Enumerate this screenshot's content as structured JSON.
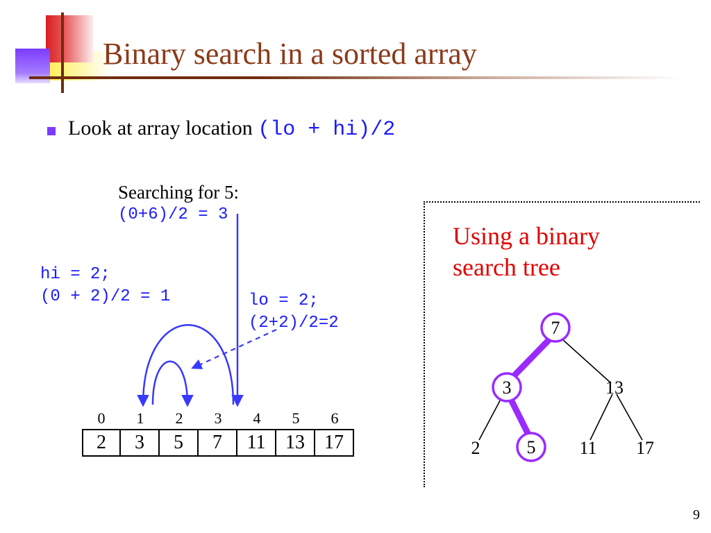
{
  "title": "Binary search in a sorted array",
  "bullet": {
    "text": "Look at array location ",
    "code": "(lo + hi)/2"
  },
  "search": {
    "heading": "Searching for 5:",
    "maincalc": "(0+6)/2 = 3",
    "hi_line1": "hi = 2;",
    "hi_line2": "(0 + 2)/2 = 1",
    "lo_line1": "lo = 2;",
    "lo_line2": "(2+2)/2=2"
  },
  "array": {
    "indices": [
      "0",
      "1",
      "2",
      "3",
      "4",
      "5",
      "6"
    ],
    "values": [
      "2",
      "3",
      "5",
      "7",
      "11",
      "13",
      "17"
    ]
  },
  "tree": {
    "title1": "Using a binary",
    "title2": "search tree",
    "nodes": {
      "root": "7",
      "l": "3",
      "r": "13",
      "ll": "2",
      "lr": "5",
      "rl": "11",
      "rr": "17"
    },
    "path": [
      "root",
      "l",
      "lr"
    ]
  },
  "slide_number": "9"
}
